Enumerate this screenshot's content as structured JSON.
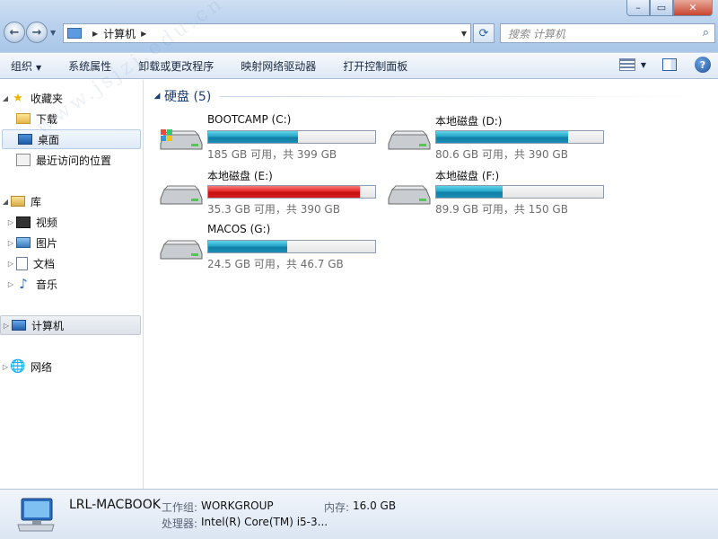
{
  "address": {
    "crumb": "计算机",
    "search_placeholder": "搜索 计算机"
  },
  "toolbar": {
    "organize": "组织",
    "properties": "系统属性",
    "uninstall": "卸载或更改程序",
    "map_drive": "映射网络驱动器",
    "control_panel": "打开控制面板"
  },
  "nav": {
    "favorites": "收藏夹",
    "downloads": "下载",
    "desktop": "桌面",
    "recent": "最近访问的位置",
    "libraries": "库",
    "videos": "视频",
    "pictures": "图片",
    "documents": "文档",
    "music": "音乐",
    "computer": "计算机",
    "network": "网络"
  },
  "group": {
    "title": "硬盘 (5)"
  },
  "drives": [
    {
      "name": "BOOTCAMP (C:)",
      "free_text": "185 GB 可用，共 399 GB",
      "used_fraction": 0.536,
      "color": "#1a8fb8",
      "state": "normal"
    },
    {
      "name": "本地磁盘 (D:)",
      "free_text": "80.6 GB 可用，共 390 GB",
      "used_fraction": 0.793,
      "color": "#1a8fb8",
      "state": "normal"
    },
    {
      "name": "本地磁盘 (E:)",
      "free_text": "35.3 GB 可用，共 390 GB",
      "used_fraction": 0.91,
      "color": "#d81c1c",
      "state": "low"
    },
    {
      "name": "本地磁盘 (F:)",
      "free_text": "89.9 GB 可用，共 150 GB",
      "used_fraction": 0.4,
      "color": "#1a8fb8",
      "state": "normal"
    },
    {
      "name": "MACOS (G:)",
      "free_text": "24.5 GB 可用，共 46.7 GB",
      "used_fraction": 0.475,
      "color": "#1a8fb8",
      "state": "normal"
    }
  ],
  "details": {
    "hostname": "LRL-MACBOOK",
    "workgroup_label": "工作组:",
    "workgroup": "WORKGROUP",
    "memory_label": "内存:",
    "memory": "16.0 GB",
    "cpu_label": "处理器:",
    "cpu": "Intel(R) Core(TM) i5-3..."
  },
  "watermark": "www.jsjzi.edu.cn"
}
